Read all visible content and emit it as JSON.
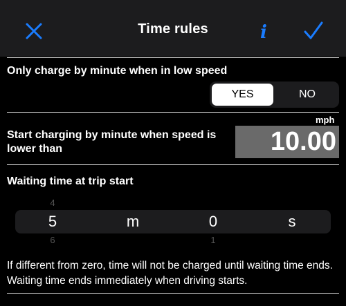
{
  "nav": {
    "title": "Time rules",
    "close_icon": "close-icon",
    "info_icon": "info-icon",
    "done_icon": "checkmark-icon",
    "accent_color": "#1a7cff"
  },
  "low_speed_section": {
    "label": "Only charge by minute when in low speed",
    "options": [
      "YES",
      "NO"
    ],
    "selected": "YES"
  },
  "speed_section": {
    "label": "Start charging by minute when speed is lower than",
    "unit": "mph",
    "value": "10.00"
  },
  "waiting_section": {
    "label": "Waiting time at trip start",
    "picker": {
      "minutes": {
        "above": "4",
        "selected": "5",
        "below": "6"
      },
      "minutes_unit": "m",
      "seconds": {
        "above": "",
        "selected": "0",
        "below": "1"
      },
      "seconds_unit": "s"
    }
  },
  "note": "If different from zero, time will not be charged until waiting time ends. Waiting time ends immediately when driving starts."
}
